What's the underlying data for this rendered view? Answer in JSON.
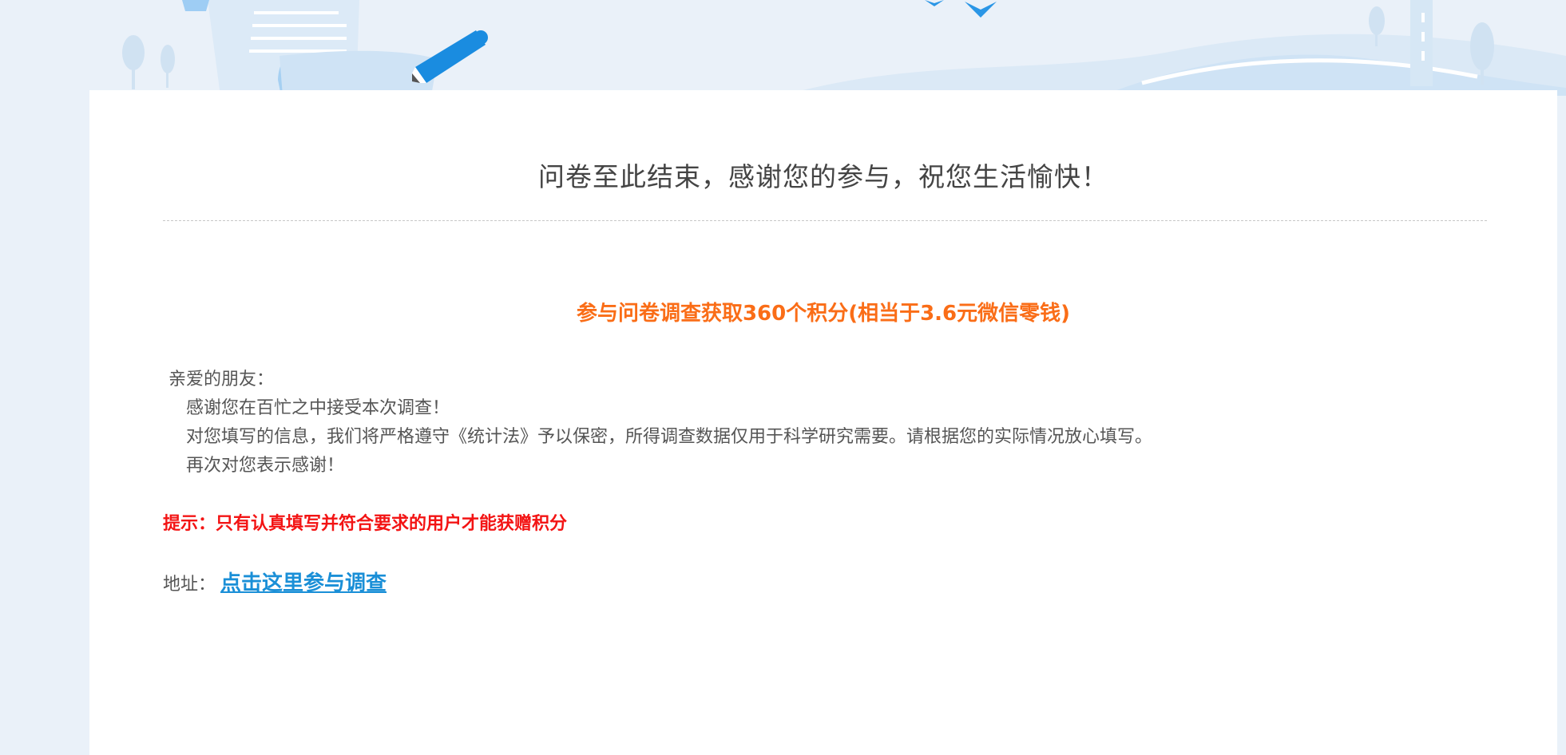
{
  "banner": {
    "colors": {
      "background": "#eaf1f9",
      "light_blue": "#cfe3f5",
      "pen_blue": "#1a8ce0"
    }
  },
  "card": {
    "title": "问卷至此结束，感谢您的参与，祝您生活愉快！",
    "reward_text": "参与问卷调查获取360个积分(相当于3.6元微信零钱)",
    "intro": {
      "greeting": "亲爱的朋友：",
      "lines": [
        "感谢您在百忙之中接受本次调查！",
        "对您填写的信息，我们将严格遵守《统计法》予以保密，所得调查数据仅用于科学研究需要。请根据您的实际情况放心填写。",
        "再次对您表示感谢！"
      ]
    },
    "hint": "提示：只有认真填写并符合要求的用户才能获赠积分",
    "address": {
      "label": "地址：",
      "link_text": "点击这里参与调查"
    }
  },
  "colors": {
    "reward": "#fa6d17",
    "hint": "#f31414",
    "link": "#1a8fd7",
    "text": "#555555"
  }
}
